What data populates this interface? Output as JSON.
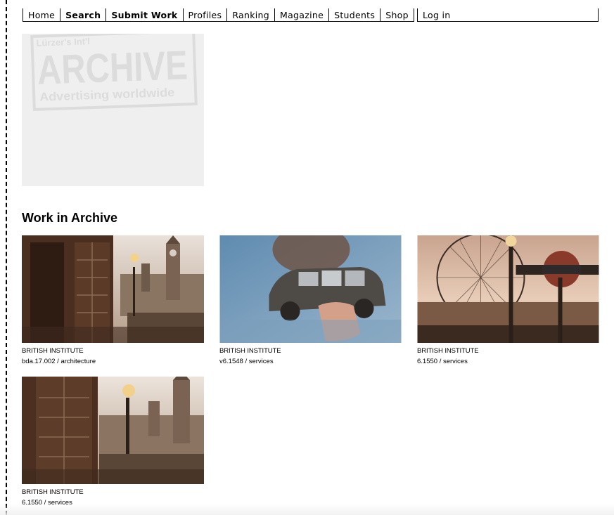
{
  "nav": {
    "items": [
      {
        "label": "Home",
        "bold": false
      },
      {
        "label": "Search",
        "bold": true
      },
      {
        "label": "Submit Work",
        "bold": true
      },
      {
        "label": "Profiles",
        "bold": false
      },
      {
        "label": "Ranking",
        "bold": false
      },
      {
        "label": "Magazine",
        "bold": false
      },
      {
        "label": "Students",
        "bold": false
      },
      {
        "label": "Shop",
        "bold": false
      }
    ],
    "login_label": "Log in"
  },
  "logo": {
    "line1": "Lürzer's Int'l",
    "line2": "ARCHIVE",
    "line3": "Advertising worldwide"
  },
  "section": {
    "title": "Work in Archive"
  },
  "works": [
    {
      "client": "BRITISH INSTITUTE",
      "meta": "bda.17.002 / architecture"
    },
    {
      "client": "BRITISH INSTITUTE",
      "meta": "v6.1548 / services"
    },
    {
      "client": "BRITISH INSTITUTE",
      "meta": "6.1550 / services"
    },
    {
      "client": "BRITISH INSTITUTE",
      "meta": "6.1550 / services"
    }
  ],
  "colors": {
    "logo_bg": "#efefef",
    "logo_text": "#dcdcdc"
  }
}
